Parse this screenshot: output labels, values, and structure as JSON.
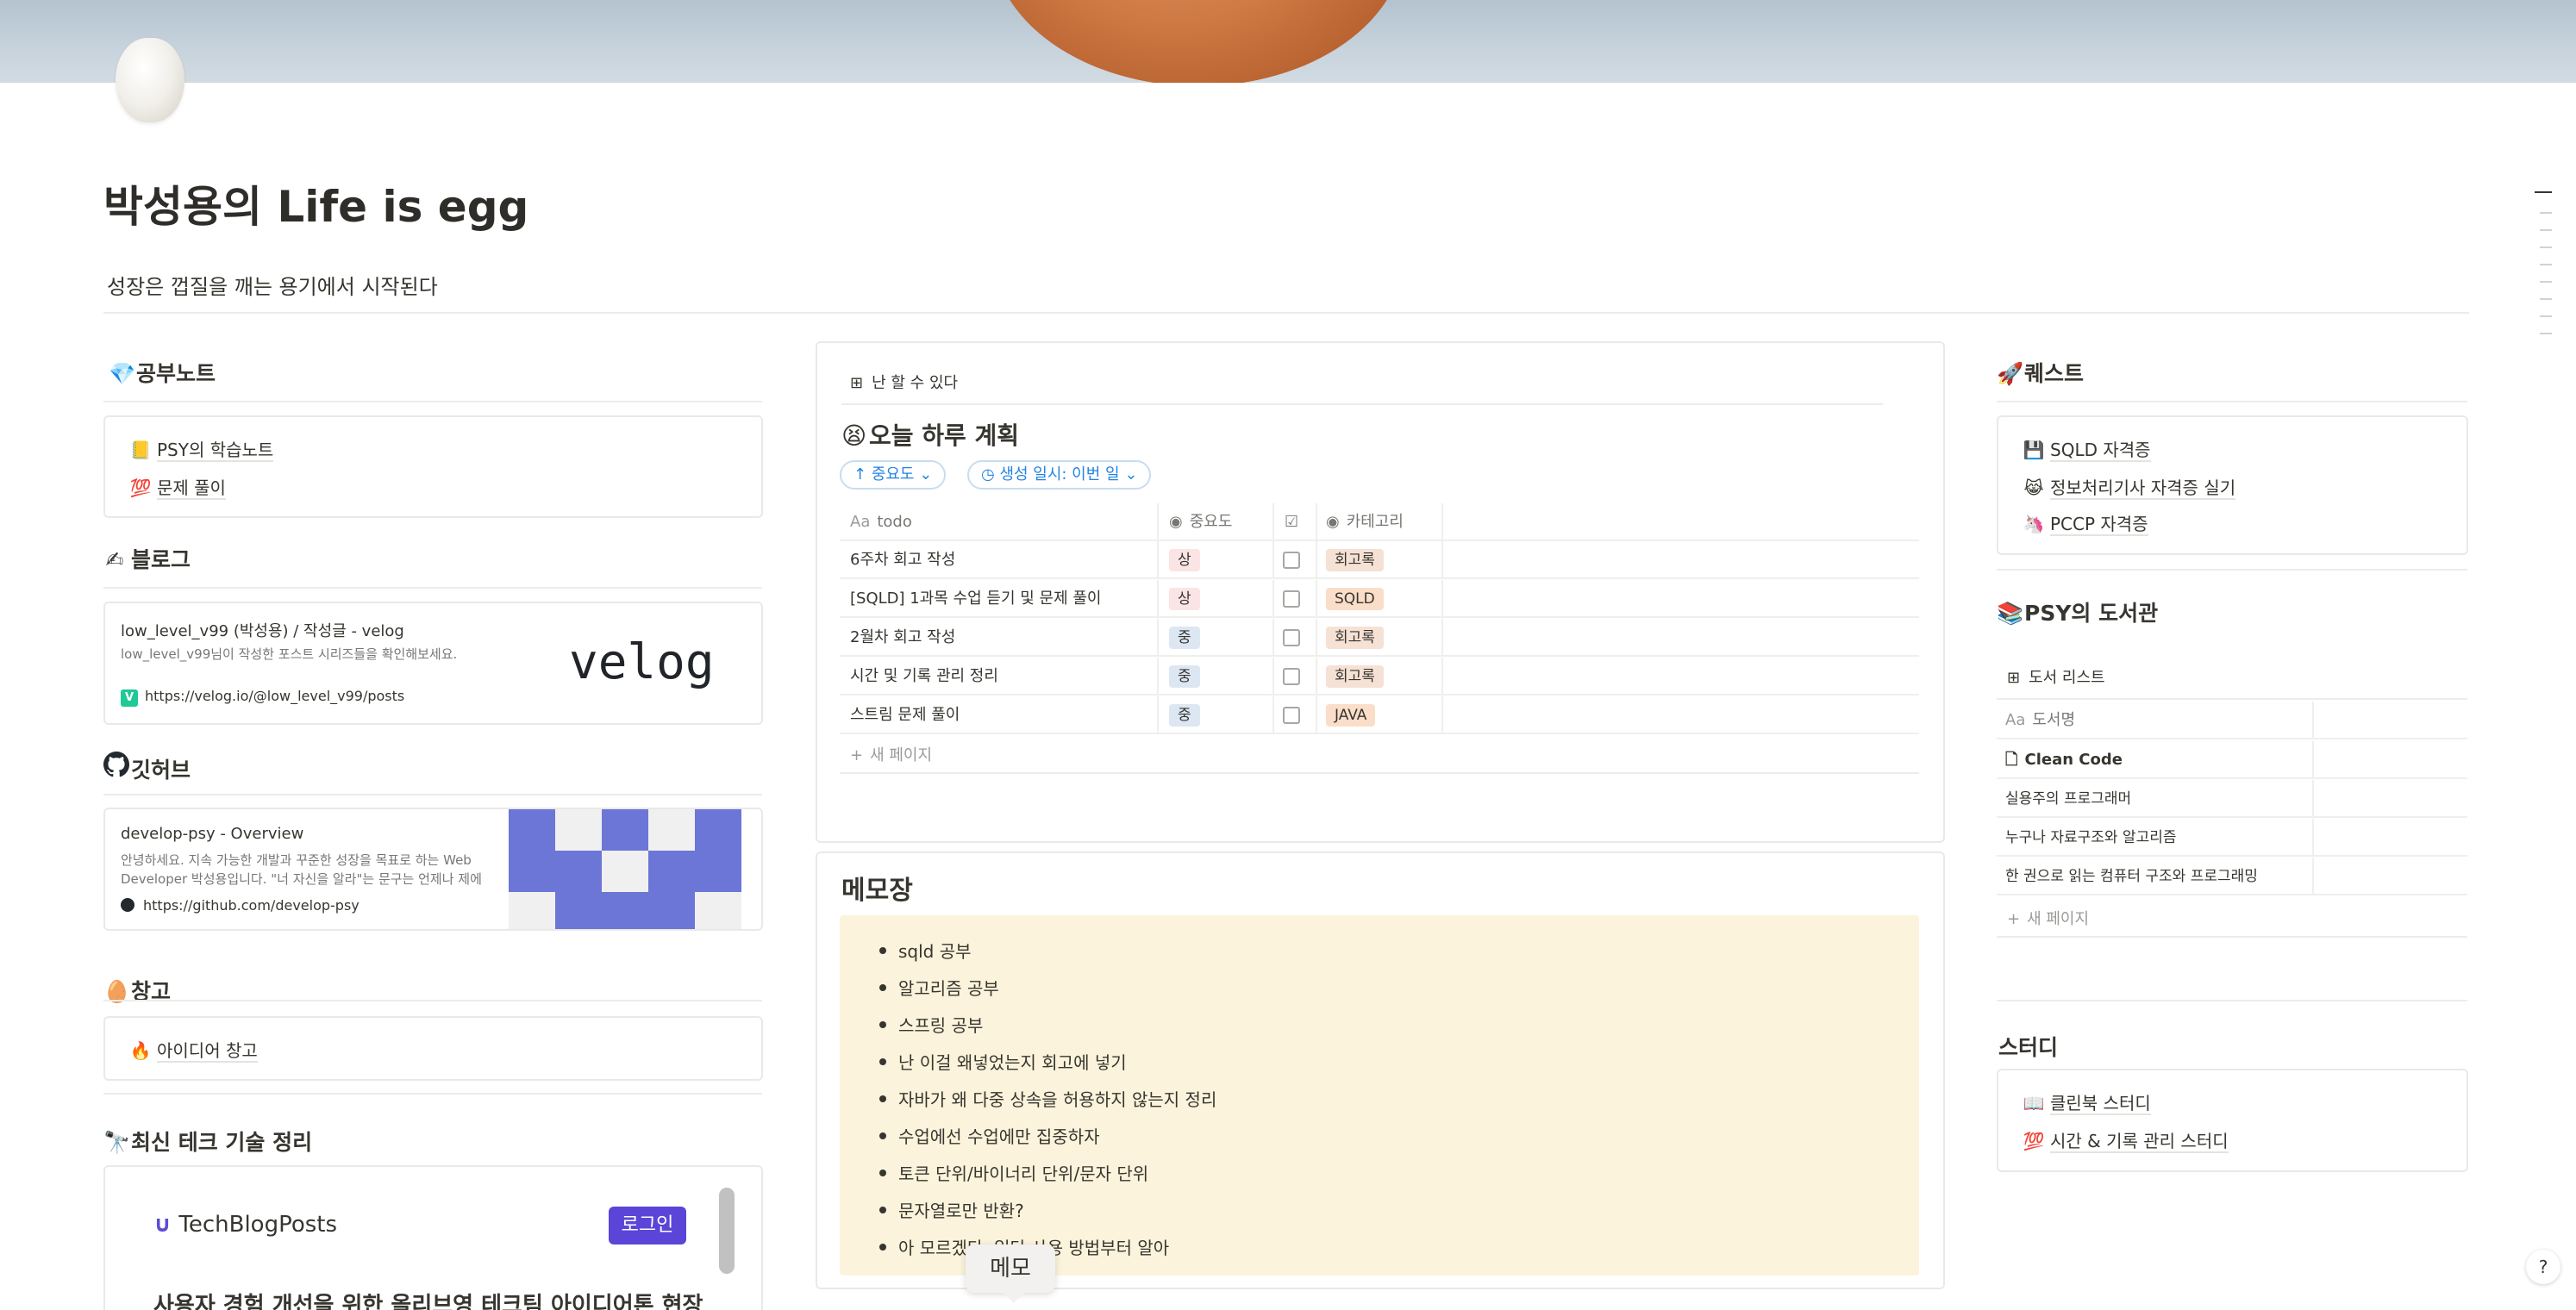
{
  "page": {
    "title": "박성용의 Life is egg",
    "subtitle": "성장은 껍질을 깨는 용기에서 시작된다"
  },
  "study": {
    "heading": "공부노트",
    "items": [
      {
        "icon": "📒",
        "label": "PSY의 학습노트"
      },
      {
        "icon": "💯",
        "label": "문제 풀이"
      }
    ]
  },
  "blog": {
    "heading": "블로그",
    "card": {
      "title": "low_level_v99 (박성용) / 작성글 - velog",
      "desc": "low_level_v99님이 작성한 포스트 시리즈들을 확인해보세요.",
      "url": "https://velog.io/@low_level_v99/posts",
      "logo": "velog"
    }
  },
  "github": {
    "heading": "깃허브",
    "card": {
      "title": "develop-psy - Overview",
      "desc": "안녕하세요. 지속 가능한 개발과 꾸준한 성장을 목표로 하는 Web Developer 박성용입니다. \"너 자신을 알라\"는 문구는 언제나 제에",
      "url": "https://github.com/develop-psy"
    }
  },
  "storage": {
    "heading": "창고",
    "items": [
      {
        "icon": "🔥",
        "label": "아이디어 창고"
      }
    ]
  },
  "tech": {
    "heading": "최신 테크 기술 정리",
    "brand": "TechBlogPosts",
    "login": "로그인",
    "article": "사용자 경험 개선을 위한 올리브영 테크팀 아이디어톤 현장"
  },
  "plan": {
    "view_label": "난 할 수 있다",
    "title": "오늘 하루 계획",
    "title_icon": "😫",
    "filters": [
      "중요도",
      "생성 일시: 이번 일"
    ],
    "columns": [
      "todo",
      "중요도",
      "카테고리"
    ],
    "rows": [
      {
        "todo": "6주차 회고 작성",
        "priority": "상",
        "category": "회고록"
      },
      {
        "todo": "[SQLD] 1과목 수업 듣기 및 문제 풀이",
        "priority": "상",
        "category": "SQLD"
      },
      {
        "todo": "2월차 회고 작성",
        "priority": "중",
        "category": "회고록"
      },
      {
        "todo": "시간 및 기록 관리 정리",
        "priority": "중",
        "category": "회고록"
      },
      {
        "todo": "스트림 문제 풀이",
        "priority": "중",
        "category": "JAVA"
      }
    ],
    "new_page": "새 페이지",
    "colors": {
      "high": "#fbe4e4",
      "mid": "#dde7f3",
      "memo": "#f6e1d5",
      "sqld": "#fadec9",
      "java": "#fadec9"
    }
  },
  "memo": {
    "heading": "메모장",
    "items": [
      "sqld 공부",
      "알고리즘 공부",
      "스프링 공부",
      "난 이걸 왜넣었는지 회고에 넣기",
      "자바가 왜 다중 상속을 허용하지 않는지 정리",
      "수업에선 수업에만 집중하자",
      "토큰 단위/바이너리 단위/문자 단위",
      "문자열로만 반환?",
      "아 모르겠다. 일단 사용 방법부터 알아"
    ],
    "tooltip": "메모"
  },
  "quest": {
    "heading": "퀘스트",
    "items": [
      {
        "icon": "💾",
        "label": "SQLD 자격증"
      },
      {
        "icon": "😹",
        "label": "정보처리기사 자격증 실기"
      },
      {
        "icon": "🦄",
        "label": "PCCP 자격증"
      }
    ]
  },
  "library": {
    "heading": "PSY의 도서관",
    "view_label": "도서 리스트",
    "column": "도서명",
    "rows": [
      "Clean Code",
      "실용주의 프로그래머",
      "누구나 자료구조와 알고리즘",
      "한 권으로 읽는 컴퓨터 구조와 프로그래밍"
    ],
    "new_page": "새 페이지"
  },
  "studygroup": {
    "heading": "스터디",
    "items": [
      {
        "icon": "📖",
        "label": "클린북 스터디"
      },
      {
        "icon": "💯",
        "label": "시간 & 기록 관리 스터디"
      }
    ]
  }
}
